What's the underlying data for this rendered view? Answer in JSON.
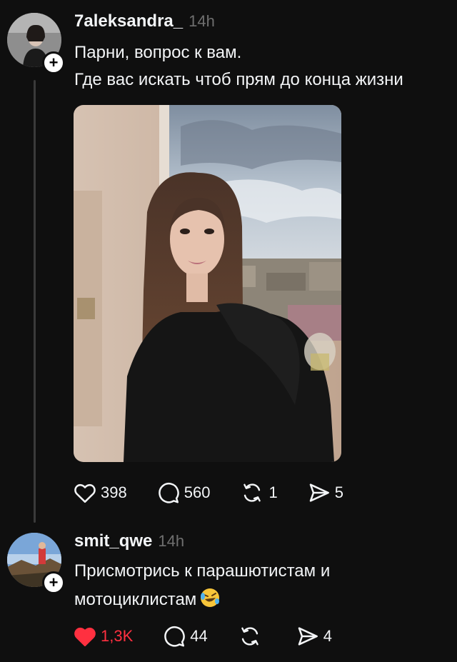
{
  "posts": [
    {
      "username": "7aleksandra_",
      "time": "14h",
      "lines": [
        "Парни, вопрос к вам.",
        "Где вас искать чтоб прям до конца жизни"
      ],
      "likes": "398",
      "comments": "560",
      "reposts": "1",
      "shares": "5"
    },
    {
      "username": "smit_qwe",
      "time": "14h",
      "lines": [
        "Присмотрись к парашютистам и",
        "мотоциклистам"
      ],
      "likes": "1,3K",
      "comments": "44",
      "reposts": "",
      "shares": "4"
    }
  ],
  "icons": {
    "follow": "plus-icon",
    "like": "heart-icon",
    "comment": "speech-bubble-icon",
    "repost": "repost-arrows-icon",
    "share": "paper-plane-icon",
    "emoji": "rolling-laughing-emoji-icon"
  },
  "colors": {
    "background": "#0f0f0f",
    "text": "#f3f5f7",
    "muted": "#6f6f6f",
    "liked": "#ff3040"
  }
}
